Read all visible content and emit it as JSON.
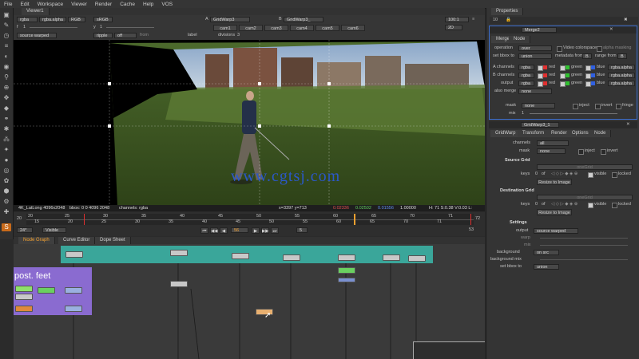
{
  "menubar": {
    "items": [
      "File",
      "Edit",
      "Workspace",
      "Viewer",
      "Render",
      "Cache",
      "Help",
      "VOS"
    ]
  },
  "viewer": {
    "tab_label": "Viewer1",
    "controls": {
      "channels_a": "rgba",
      "channels_b": "rgba.alpha",
      "display": "RGB",
      "colorspace": "sRGB",
      "input_a": "A",
      "input_a_node": "GridWarp3",
      "input_b": "B",
      "input_b_node": "GridWarp3_",
      "zoom_value": "100:1",
      "gain_label": "f",
      "gain_value": "1",
      "gamma_label": "y",
      "gamma_value": "1",
      "proxy": "2D",
      "source": "source warped",
      "ripple": "ripple",
      "ripple_mode": "off",
      "from_label": "from",
      "label_text": "label",
      "divisions_label": "divisions",
      "divisions_value": "3",
      "cams": [
        "cam1",
        "cam2",
        "cam3",
        "cam4",
        "cam5",
        "cam6"
      ]
    },
    "status": {
      "format": "4K_LatLong 4096x2048",
      "bbox": "bbox: 0 0 4096 2048",
      "channels": "channels: rgba",
      "coords": "x=3397 y=713",
      "r": "0.02336",
      "g": "0.02502",
      "b": "0.01556",
      "a": "1.00000",
      "hsvl": "H: 71 S:0.38 V:0.03 L: 0.02399"
    }
  },
  "timeline": {
    "start_frame": "20",
    "end_frame": "72",
    "fps": "24*",
    "mode": "Visible",
    "current_frame": "56",
    "increment": "5",
    "end_label": "53",
    "ruler_top": [
      "20",
      "25",
      "30",
      "35",
      "40",
      "45",
      "50",
      "55",
      "60",
      "65",
      "70",
      "71"
    ],
    "ruler_bottom": [
      "15",
      "20",
      "25",
      "30",
      "35",
      "40",
      "45",
      "50",
      "55",
      "60",
      "65",
      "70",
      "71"
    ]
  },
  "panels": {
    "tabs": [
      "Node Graph",
      "Curve Editor",
      "Dope Sheet"
    ]
  },
  "nodegraph": {
    "backdrop_text": "post. feet"
  },
  "properties": {
    "tab_label": "Properties",
    "merge": {
      "title": "Merge2",
      "tabs": [
        "Merge",
        "Node"
      ],
      "operation_label": "operation",
      "operation_value": "over",
      "video_colorspace_label": "Video colorspace",
      "alpha_masking_label": "alpha masking",
      "set_bbox_label": "set bbox to",
      "set_bbox_value": "union",
      "metadata_label": "metadata from",
      "metadata_value": "B",
      "range_label": "range from",
      "range_value": "B",
      "a_channels_label": "A channels",
      "b_channels_label": "B channels",
      "output_label": "output",
      "also_merge_label": "also merge",
      "also_merge_value": "none",
      "rgba": "rgba",
      "red": "red",
      "green": "green",
      "blue": "blue",
      "alpha": "rgba.alpha",
      "mask_label": "mask",
      "mask_value": "none",
      "inject_label": "inject",
      "invert_label": "invert",
      "fringe_label": "fringe",
      "mix_label": "mix",
      "mix_value": "1"
    },
    "gridwarp": {
      "title": "GridWarp3_1",
      "tabs": [
        "GridWarp",
        "Transform",
        "Render",
        "Options",
        "Node"
      ],
      "channels_label": "channels",
      "channels_value": "all",
      "mask_label": "mask",
      "mask_value": "none",
      "inject_label": "inject",
      "invert_label": "invert",
      "source_grid_label": "Source Grid",
      "keys_label": "keys",
      "of_label": "of",
      "keys_value": "0",
      "visible_label": "visible",
      "locked_label": "locked",
      "resize_label": "Resize to Image",
      "dest_grid_label": "Destination Grid",
      "settings_label": "Settings",
      "output_label": "output",
      "output_value": "source warped",
      "warp_label": "warp",
      "mix_label": "mix",
      "background_label": "background",
      "background_value": "on src",
      "background_mix_label": "background mix",
      "set_bbox_label": "set bbox to",
      "set_bbox_value": "union",
      "default_grid": "oneGrid"
    }
  },
  "watermark": "www.cgtsj.com",
  "colors": {
    "accent": "#f2a030",
    "backdrop_teal": "#3aa69a",
    "backdrop_purple": "#8a6bd0",
    "merge_blue": "#3c6fd0"
  }
}
